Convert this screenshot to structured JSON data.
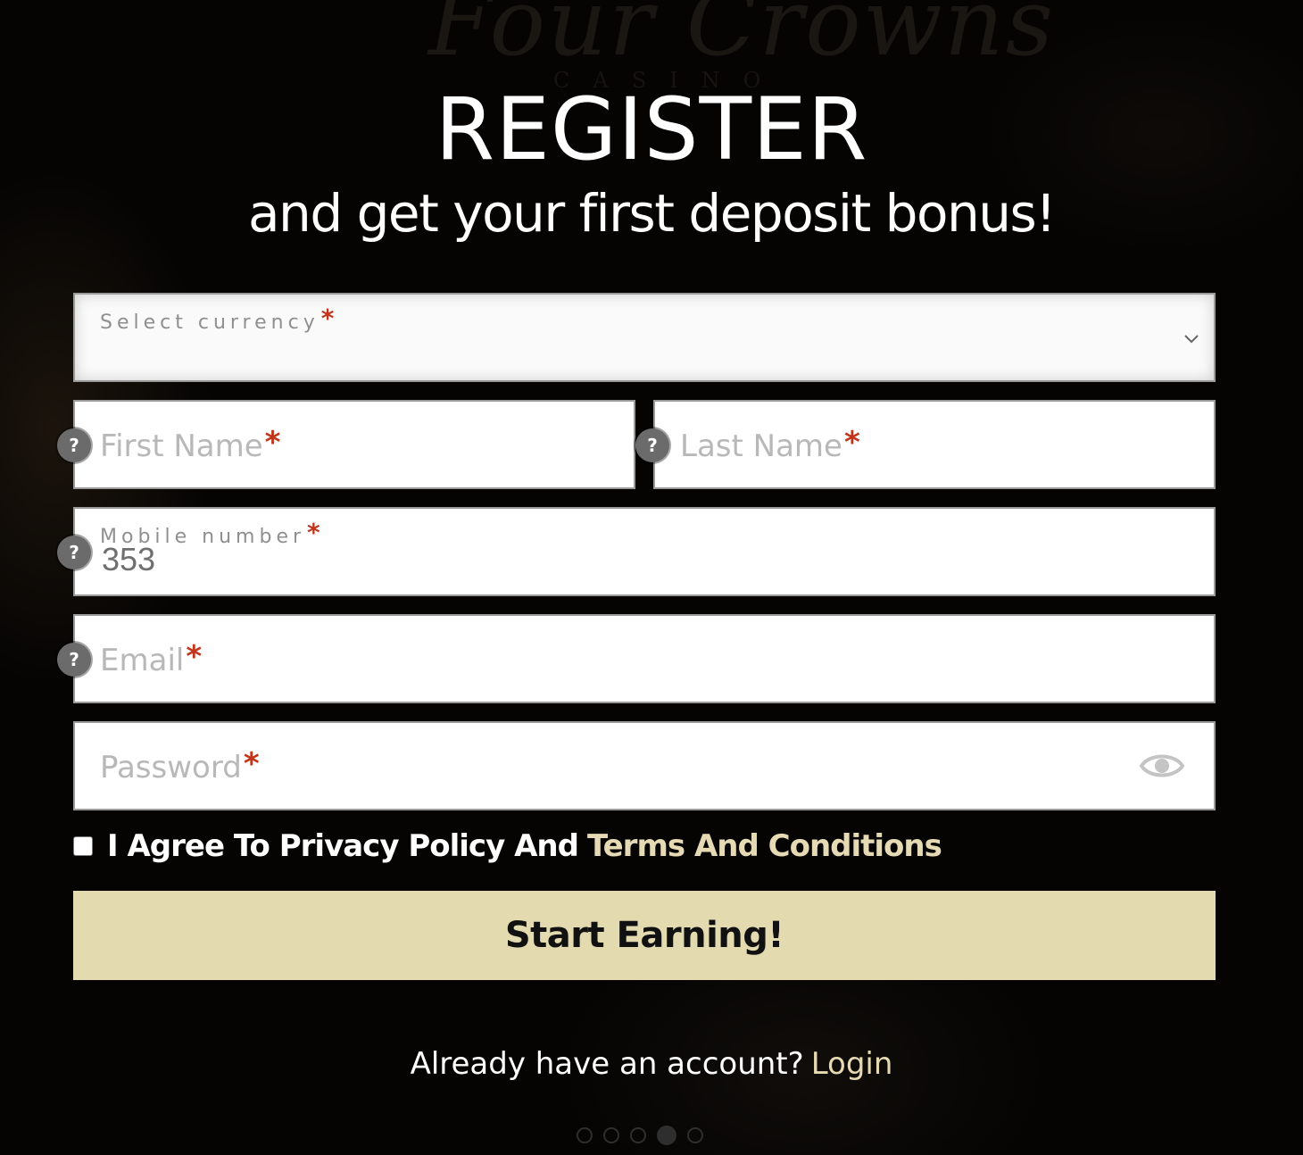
{
  "background_logo": {
    "text": "Four Crowns",
    "subtext": "CASINO"
  },
  "heading": "REGISTER",
  "subheading": "and get your first deposit bonus!",
  "form": {
    "currency": {
      "label": "Select currency",
      "required_mark": "*",
      "icon": "chevron-down-icon"
    },
    "first_name": {
      "placeholder": "First Name",
      "required_mark": "*",
      "help": "?"
    },
    "last_name": {
      "placeholder": "Last Name",
      "required_mark": "*",
      "help": "?"
    },
    "mobile": {
      "label": "Mobile number",
      "required_mark": "*",
      "value": "353",
      "help": "?"
    },
    "email": {
      "placeholder": "Email",
      "required_mark": "*",
      "help": "?"
    },
    "password": {
      "placeholder": "Password",
      "required_mark": "*",
      "icon": "eye-icon"
    }
  },
  "agree": {
    "checked": false,
    "text": "I Agree To Privacy Policy And",
    "link": "Terms And Conditions"
  },
  "submit_label": "Start Earning!",
  "login": {
    "text": "Already have an account?",
    "link": "Login"
  },
  "carousel": {
    "count": 5,
    "active_index": 3
  },
  "colors": {
    "background": "#050403",
    "accent": "#e4dab0",
    "link": "#e6dab4",
    "required": "#c2351b",
    "help_icon": "#6b6b6b"
  }
}
